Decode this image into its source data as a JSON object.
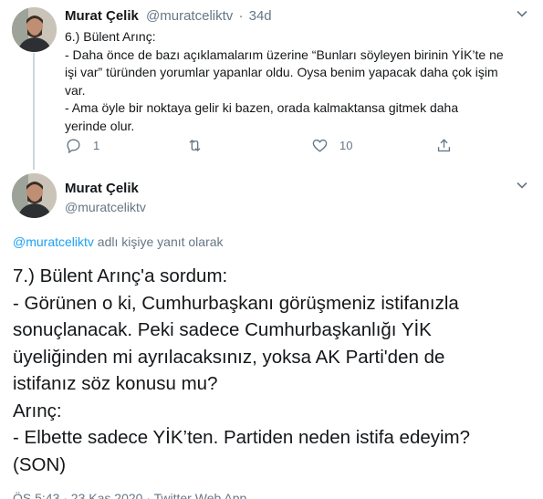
{
  "tweet1": {
    "name": "Murat Çelik",
    "handle": "@muratceliktv",
    "time": "34d",
    "lines": [
      "6.) Bülent Arınç:",
      "- Daha önce de bazı açıklamalarım üzerine “Bunları söyleyen birinin YİK’te ne",
      "işi var” türünden yorumlar yapanlar oldu. Oysa benim yapacak daha çok işim",
      "var.",
      "- Ama öyle bir noktaya gelir ki bazen, orada kalmaktansa gitmek daha",
      "yerinde olur."
    ],
    "reply_count": "1",
    "retweet_count": "",
    "like_count": "10"
  },
  "tweet2": {
    "name": "Murat Çelik",
    "handle": "@muratceliktv",
    "reply_to_handle": "@muratceliktv",
    "reply_to_suffix": " adlı kişiye yanıt olarak",
    "lines": [
      "7.) Bülent Arınç'a sordum:",
      "- Görünen o ki, Cumhurbaşkanı görüşmeniz istifanızla",
      "sonuçlanacak. Peki sadece Cumhurbaşkanlığı YİK",
      "üyeliğinden mi ayrılacaksınız, yoksa AK Parti'den de",
      "istifanız söz konusu mu?",
      "Arınç:",
      "- Elbette sadece YİK’ten. Partiden neden istifa edeyim?",
      "(SON)"
    ],
    "footer": "ÖS 5:43 · 23 Kas 2020 · Twitter Web App"
  },
  "icons": {
    "caret": "chevron-down-icon",
    "reply": "reply-icon",
    "retweet": "retweet-icon",
    "like": "heart-icon",
    "share": "share-icon"
  },
  "colors": {
    "text": "#14171a",
    "secondary": "#657786",
    "link": "#1da1f2",
    "thread_line": "#ccd6dd"
  }
}
